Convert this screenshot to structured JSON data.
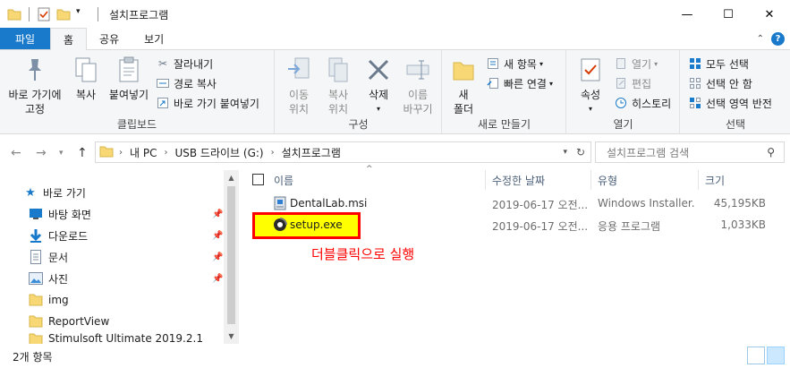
{
  "window": {
    "title": "설치프로그램",
    "controls": [
      "minimize",
      "maximize",
      "close"
    ]
  },
  "ribbon_tabs": [
    "파일",
    "홈",
    "공유",
    "보기"
  ],
  "active_tab": "홈",
  "ribbon": {
    "clipboard": {
      "label": "클립보드",
      "pin_quick_access": "바로 가기에\n고정",
      "copy": "복사",
      "paste": "붙여넣기",
      "cut": "잘라내기",
      "copy_path": "경로 복사",
      "paste_shortcut": "바로 가기 붙여넣기"
    },
    "organize": {
      "label": "구성",
      "move_to": "이동\n위치",
      "copy_to": "복사\n위치",
      "delete": "삭제",
      "rename": "이름\n바꾸기"
    },
    "new": {
      "label": "새로 만들기",
      "new_folder": "새\n폴더",
      "new_item": "새 항목",
      "easy_access": "빠른 연결"
    },
    "open": {
      "label": "열기",
      "properties": "속성",
      "open": "열기",
      "edit": "편집",
      "history": "히스토리"
    },
    "select": {
      "label": "선택",
      "select_all": "모두 선택",
      "select_none": "선택 안 함",
      "invert": "선택 영역 반전"
    }
  },
  "address": {
    "segments": [
      "내 PC",
      "USB 드라이브 (G:)",
      "설치프로그램"
    ]
  },
  "search": {
    "placeholder": "설치프로그램 검색"
  },
  "nav_pane": {
    "items": [
      {
        "label": "바로 가기",
        "icon": "star-icon",
        "pinned": false
      },
      {
        "label": "바탕 화면",
        "icon": "desktop-icon",
        "pinned": true
      },
      {
        "label": "다운로드",
        "icon": "download-icon",
        "pinned": true
      },
      {
        "label": "문서",
        "icon": "document-icon",
        "pinned": true
      },
      {
        "label": "사진",
        "icon": "picture-icon",
        "pinned": true
      },
      {
        "label": "img",
        "icon": "folder-icon",
        "pinned": false
      },
      {
        "label": "ReportView",
        "icon": "folder-icon",
        "pinned": false
      },
      {
        "label": "Stimulsoft Ultimate 2019.2.1",
        "icon": "folder-icon",
        "pinned": false
      }
    ]
  },
  "file_list": {
    "columns": [
      "이름",
      "수정한 날짜",
      "유형",
      "크기"
    ],
    "rows": [
      {
        "name": "DentalLab.msi",
        "date": "2019-06-17 오전...",
        "type": "Windows Installer...",
        "size": "45,195KB"
      },
      {
        "name": "setup.exe",
        "date": "2019-06-17 오전...",
        "type": "응용 프로그램",
        "size": "1,033KB"
      }
    ]
  },
  "annotation": {
    "text": "더블클릭으로 실행",
    "color": "#ff0000",
    "highlight_color": "#ffff00"
  },
  "status_bar": {
    "item_count": "2개 항목"
  },
  "colors": {
    "file_tab": "#1979ca",
    "ribbon_bg": "#f5f6f7",
    "folder": "#f8d775"
  }
}
